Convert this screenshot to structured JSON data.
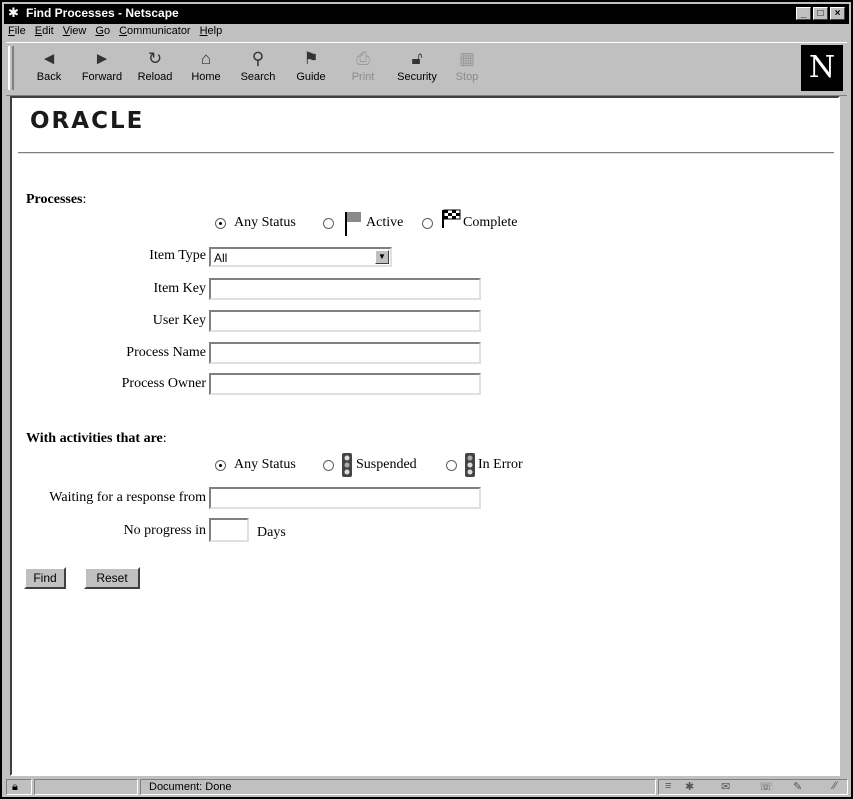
{
  "window": {
    "title": "Find Processes - Netscape"
  },
  "menubar": [
    "File",
    "Edit",
    "View",
    "Go",
    "Communicator",
    "Help"
  ],
  "toolbar": [
    {
      "label": "Back",
      "icon": "back-arrow-icon"
    },
    {
      "label": "Forward",
      "icon": "forward-arrow-icon"
    },
    {
      "label": "Reload",
      "icon": "reload-icon"
    },
    {
      "label": "Home",
      "icon": "home-icon"
    },
    {
      "label": "Search",
      "icon": "search-icon"
    },
    {
      "label": "Guide",
      "icon": "guide-icon"
    },
    {
      "label": "Print",
      "icon": "print-icon",
      "disabled": true
    },
    {
      "label": "Security",
      "icon": "lock-icon"
    },
    {
      "label": "Stop",
      "icon": "stop-icon",
      "disabled": true
    }
  ],
  "brand": {
    "logo": "ORACLE",
    "browser_logo": "N"
  },
  "processes": {
    "heading": "Processes",
    "status_options": [
      "Any Status",
      "Active",
      "Complete"
    ],
    "selected_status": "Any Status",
    "fields": {
      "item_type": {
        "label": "Item Type",
        "value": "All"
      },
      "item_key": {
        "label": "Item Key",
        "value": ""
      },
      "user_key": {
        "label": "User Key",
        "value": ""
      },
      "process_name": {
        "label": "Process Name",
        "value": ""
      },
      "process_owner": {
        "label": "Process Owner",
        "value": ""
      }
    }
  },
  "activities": {
    "heading": "With activities that are",
    "status_options": [
      "Any Status",
      "Suspended",
      "In Error"
    ],
    "selected_status": "Any Status",
    "waiting_label": "Waiting for a response from",
    "waiting_value": "",
    "no_progress_label": "No progress in",
    "no_progress_value": "",
    "days_label": "Days"
  },
  "buttons": {
    "find": "Find",
    "reset": "Reset"
  },
  "status": {
    "text": "Document: Done"
  }
}
